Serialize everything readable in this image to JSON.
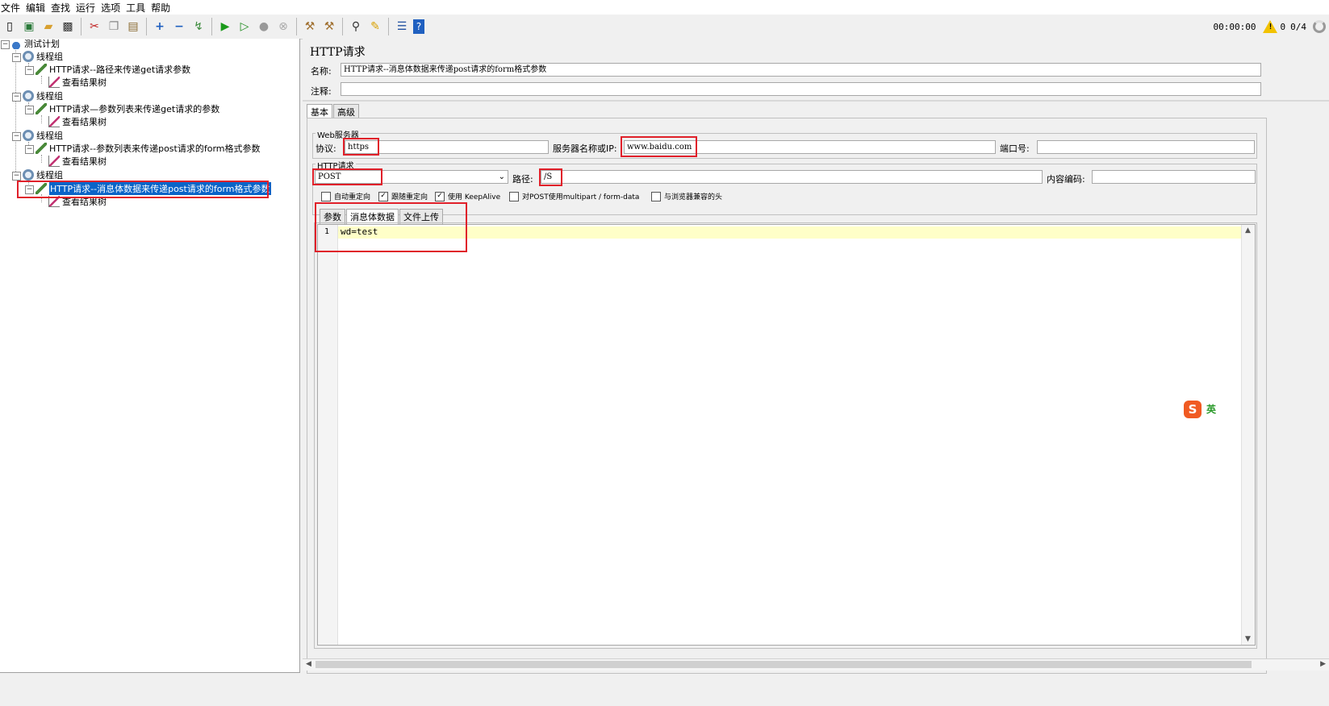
{
  "menu": [
    "文件",
    "编辑",
    "查找",
    "运行",
    "选项",
    "工具",
    "帮助"
  ],
  "status": {
    "timer": "00:00:00",
    "warnings": "0",
    "threads": "0/4"
  },
  "icons": {
    "toolbar": [
      "new-icon",
      "templates-icon",
      "open-icon",
      "save-icon",
      "cut-icon",
      "copy-icon",
      "paste-icon",
      "expand-icon",
      "collapse-icon",
      "toggle-icon",
      "start-icon",
      "start-no-timers-icon",
      "stop-icon",
      "shutdown-icon",
      "clear-icon",
      "clear-all-icon",
      "search-icon",
      "reset-search-icon",
      "function-helper-icon",
      "help-icon"
    ]
  },
  "tree": {
    "plan": "测试计划",
    "groups": [
      {
        "label": "线程组",
        "request": "HTTP请求--路径来传递get请求参数",
        "listener": "查看结果树"
      },
      {
        "label": "线程组",
        "request": "HTTP请求—参数列表来传递get请求的参数",
        "listener": "查看结果树"
      },
      {
        "label": "线程组",
        "request": "HTTP请求--参数列表来传递post请求的form格式参数",
        "listener": "查看结果树"
      },
      {
        "label": "线程组",
        "request": "HTTP请求--消息体数据来传递post请求的form格式参数",
        "listener": "查看结果树"
      }
    ]
  },
  "panel": {
    "title": "HTTP请求",
    "name_label": "名称:",
    "name_value": "HTTP请求--消息体数据来传递post请求的form格式参数",
    "comment_label": "注释:",
    "comment_value": "",
    "tabs": [
      "基本",
      "高级"
    ],
    "web_server": {
      "legend": "Web服务器",
      "protocol_label": "协议:",
      "protocol_value": "https",
      "server_label": "服务器名称或IP:",
      "server_value": "www.baidu.com",
      "port_label": "端口号:",
      "port_value": ""
    },
    "http_request": {
      "legend": "HTTP请求",
      "method": "POST",
      "path_label": "路径:",
      "path_value": "/S",
      "encoding_label": "内容编码:",
      "encoding_value": ""
    },
    "checkboxes": [
      {
        "label": "自动重定向",
        "checked": false
      },
      {
        "label": "跟随重定向",
        "checked": true
      },
      {
        "label": "使用 KeepAlive",
        "checked": true
      },
      {
        "label": "对POST使用multipart / form-data",
        "checked": false
      },
      {
        "label": "与浏览器兼容的头",
        "checked": false
      }
    ],
    "body_tabs": [
      "参数",
      "消息体数据",
      "文件上传"
    ],
    "body": {
      "line_number": "1",
      "text": "wd=test"
    }
  },
  "ime": {
    "logo": "S",
    "mode": "英"
  },
  "colors": {
    "selection": "#0a64c8",
    "highlight_box": "#e0202a",
    "editor_line": "#ffffc8"
  }
}
